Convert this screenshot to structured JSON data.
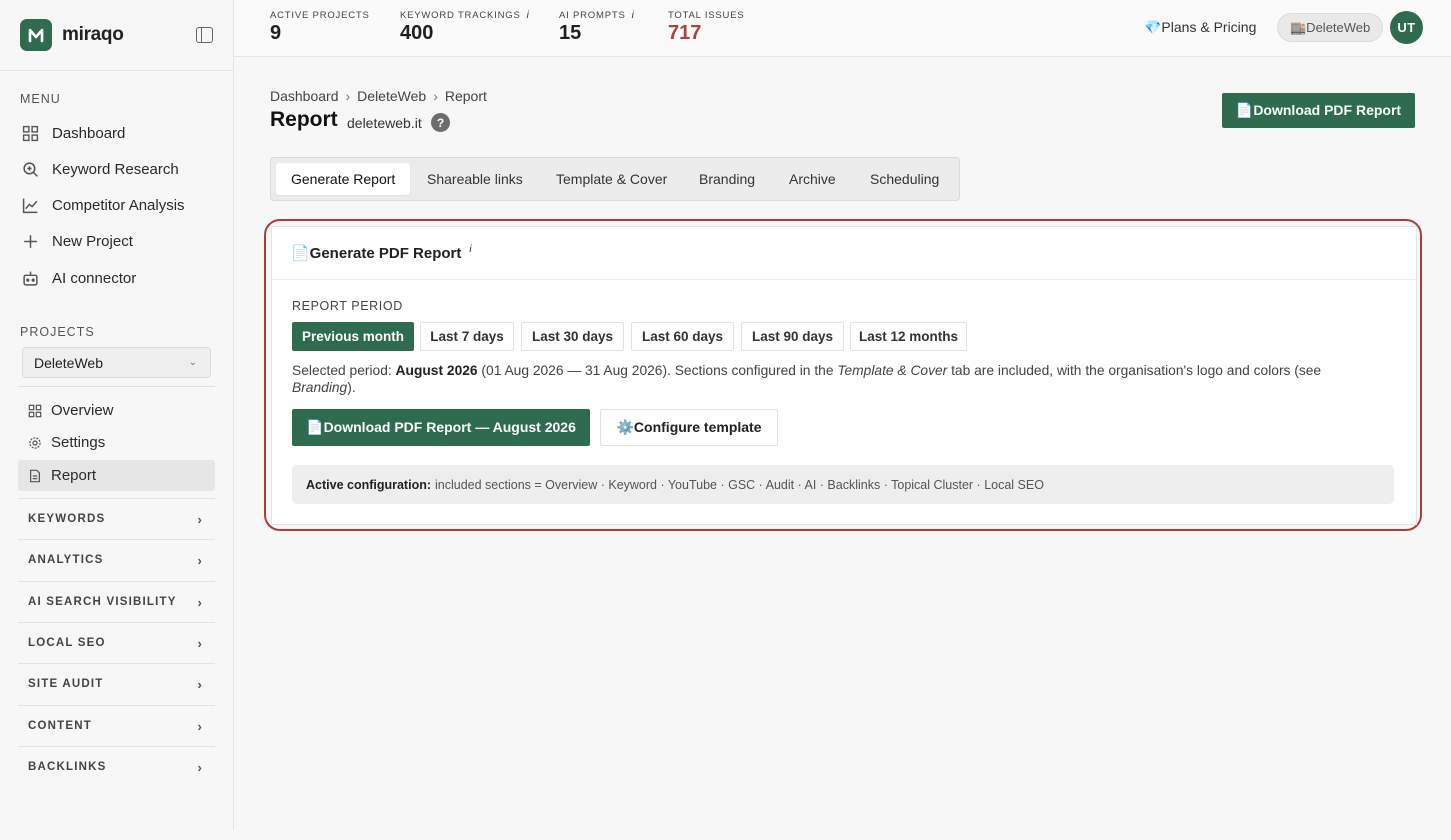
{
  "brand": {
    "logo_text": "miraqo",
    "logo_letter": "M"
  },
  "sidebar": {
    "menu_title": "MENU",
    "menu": [
      {
        "label": "Dashboard",
        "icon": "grid-icon"
      },
      {
        "label": "Keyword Research",
        "icon": "search-icon"
      },
      {
        "label": "Competitor Analysis",
        "icon": "chart-icon"
      },
      {
        "label": "New Project",
        "icon": "plus-icon"
      },
      {
        "label": "AI connector",
        "icon": "robot-icon"
      }
    ],
    "projects_title": "PROJECTS",
    "project_select": "DeleteWeb",
    "project_items": [
      {
        "label": "Overview",
        "icon": "grid-icon"
      },
      {
        "label": "Settings",
        "icon": "gear-icon"
      },
      {
        "label": "Report",
        "icon": "report-icon"
      }
    ],
    "groups": [
      "KEYWORDS",
      "ANALYTICS",
      "AI SEARCH VISIBILITY",
      "LOCAL SEO",
      "SITE AUDIT",
      "CONTENT",
      "BACKLINKS"
    ]
  },
  "topbar": {
    "stats": [
      {
        "label": "ACTIVE PROJECTS",
        "value": "9",
        "info": ""
      },
      {
        "label": "KEYWORD TRACKINGS",
        "value": "400",
        "info": "i"
      },
      {
        "label": "AI PROMPTS",
        "value": "15",
        "info": "i"
      },
      {
        "label": "TOTAL ISSUES",
        "value": "717",
        "info": ""
      }
    ],
    "plans": "💎Plans & Pricing",
    "workspace": "🏬DeleteWeb",
    "avatar": "UT"
  },
  "main": {
    "breadcrumb": [
      "Dashboard",
      "DeleteWeb",
      "Report"
    ],
    "breadcrumb_sep": "›",
    "title": "Report",
    "domain": "deleteweb.it",
    "help": "?",
    "download_top": "📄Download PDF Report",
    "tabs": [
      "Generate Report",
      "Shareable links",
      "Template & Cover",
      "Branding",
      "Archive",
      "Scheduling"
    ],
    "card": {
      "title": "📄Generate PDF Report",
      "title_info": "i",
      "period_label": "REPORT PERIOD",
      "periods": [
        "Previous month",
        "Last 7 days",
        "Last 30 days",
        "Last 60 days",
        "Last 90 days",
        "Last 12 months"
      ],
      "desc": {
        "p1": "Selected period: ",
        "bold": "August 2026",
        "p2": " (01 Aug 2026 — 31 Aug 2026). Sections configured in the ",
        "em1": "Template & Cover",
        "p3": " tab are included, with the organisation's logo and colors (see ",
        "em2": "Branding",
        "p4": ")."
      },
      "download_btn": "📄Download PDF Report — August 2026",
      "configure_btn": "⚙️Configure template",
      "config_label": "Active configuration:",
      "config_text": "included sections = Overview · Keyword · YouTube · GSC · Audit · AI · Backlinks · Topical Cluster · Local SEO"
    }
  },
  "colors": {
    "accent": "#2f6b4f",
    "issues": "#a9433b",
    "highlight": "#b23a3a"
  }
}
